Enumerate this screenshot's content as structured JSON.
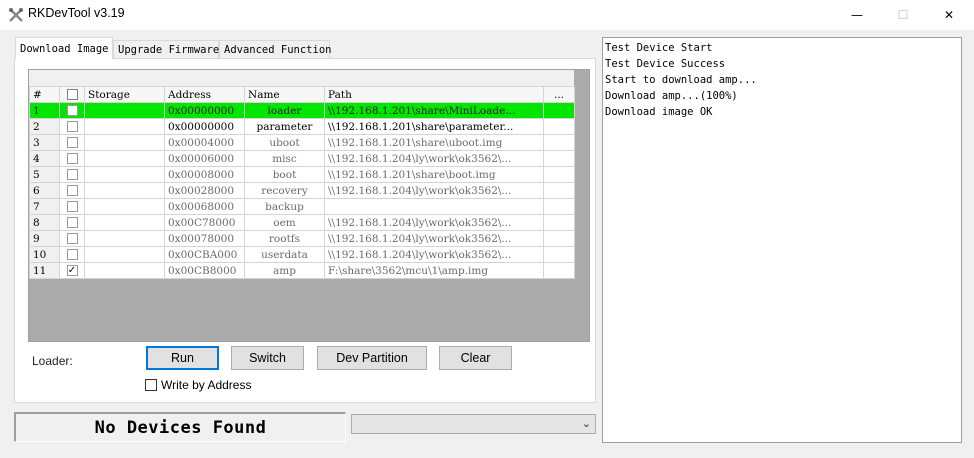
{
  "window": {
    "title": "RKDevTool v3.19",
    "min": "—",
    "max": "☐",
    "close": "✕"
  },
  "tabs": [
    "Download Image",
    "Upgrade Firmware",
    "Advanced Function"
  ],
  "grid": {
    "headers": [
      "#",
      "☐",
      "Storage",
      "Address",
      "Name",
      "Path",
      "..."
    ],
    "rows": [
      {
        "num": "1",
        "checked": false,
        "storage": "",
        "address": "0x00000000",
        "name": "loader",
        "path": "\\\\192.168.1.201\\share\\MiniLoade..."
      },
      {
        "num": "2",
        "checked": false,
        "storage": "",
        "address": "0x00000000",
        "name": "parameter",
        "path": "\\\\192.168.1.201\\share\\parameter..."
      },
      {
        "num": "3",
        "checked": false,
        "storage": "",
        "address": "0x00004000",
        "name": "uboot",
        "path": "\\\\192.168.1.201\\share\\uboot.img"
      },
      {
        "num": "4",
        "checked": false,
        "storage": "",
        "address": "0x00006000",
        "name": "misc",
        "path": "\\\\192.168.1.204\\ly\\work\\ok3562\\..."
      },
      {
        "num": "5",
        "checked": false,
        "storage": "",
        "address": "0x00008000",
        "name": "boot",
        "path": "\\\\192.168.1.201\\share\\boot.img"
      },
      {
        "num": "6",
        "checked": false,
        "storage": "",
        "address": "0x00028000",
        "name": "recovery",
        "path": "\\\\192.168.1.204\\ly\\work\\ok3562\\..."
      },
      {
        "num": "7",
        "checked": false,
        "storage": "",
        "address": "0x00068000",
        "name": "backup",
        "path": ""
      },
      {
        "num": "8",
        "checked": false,
        "storage": "",
        "address": "0x00C78000",
        "name": "oem",
        "path": "\\\\192.168.1.204\\ly\\work\\ok3562\\..."
      },
      {
        "num": "9",
        "checked": false,
        "storage": "",
        "address": "0x00078000",
        "name": "rootfs",
        "path": "\\\\192.168.1.204\\ly\\work\\ok3562\\..."
      },
      {
        "num": "10",
        "checked": false,
        "storage": "",
        "address": "0x00CBA000",
        "name": "userdata",
        "path": "\\\\192.168.1.204\\ly\\work\\ok3562\\..."
      },
      {
        "num": "11",
        "checked": true,
        "storage": "",
        "address": "0x00CB8000",
        "name": "amp",
        "path": "F:\\share\\3562\\mcu\\1\\amp.img"
      }
    ]
  },
  "controls": {
    "loader_label": "Loader:",
    "run": "Run",
    "switch": "Switch",
    "dev_partition": "Dev Partition",
    "clear": "Clear",
    "write_by_address": "Write by Address"
  },
  "status": {
    "text": "No Devices Found",
    "combo_value": ""
  },
  "log": [
    "Test Device Start",
    "Test Device Success",
    "Start to download amp...",
    "Download amp...(100%)",
    "Download image OK"
  ]
}
